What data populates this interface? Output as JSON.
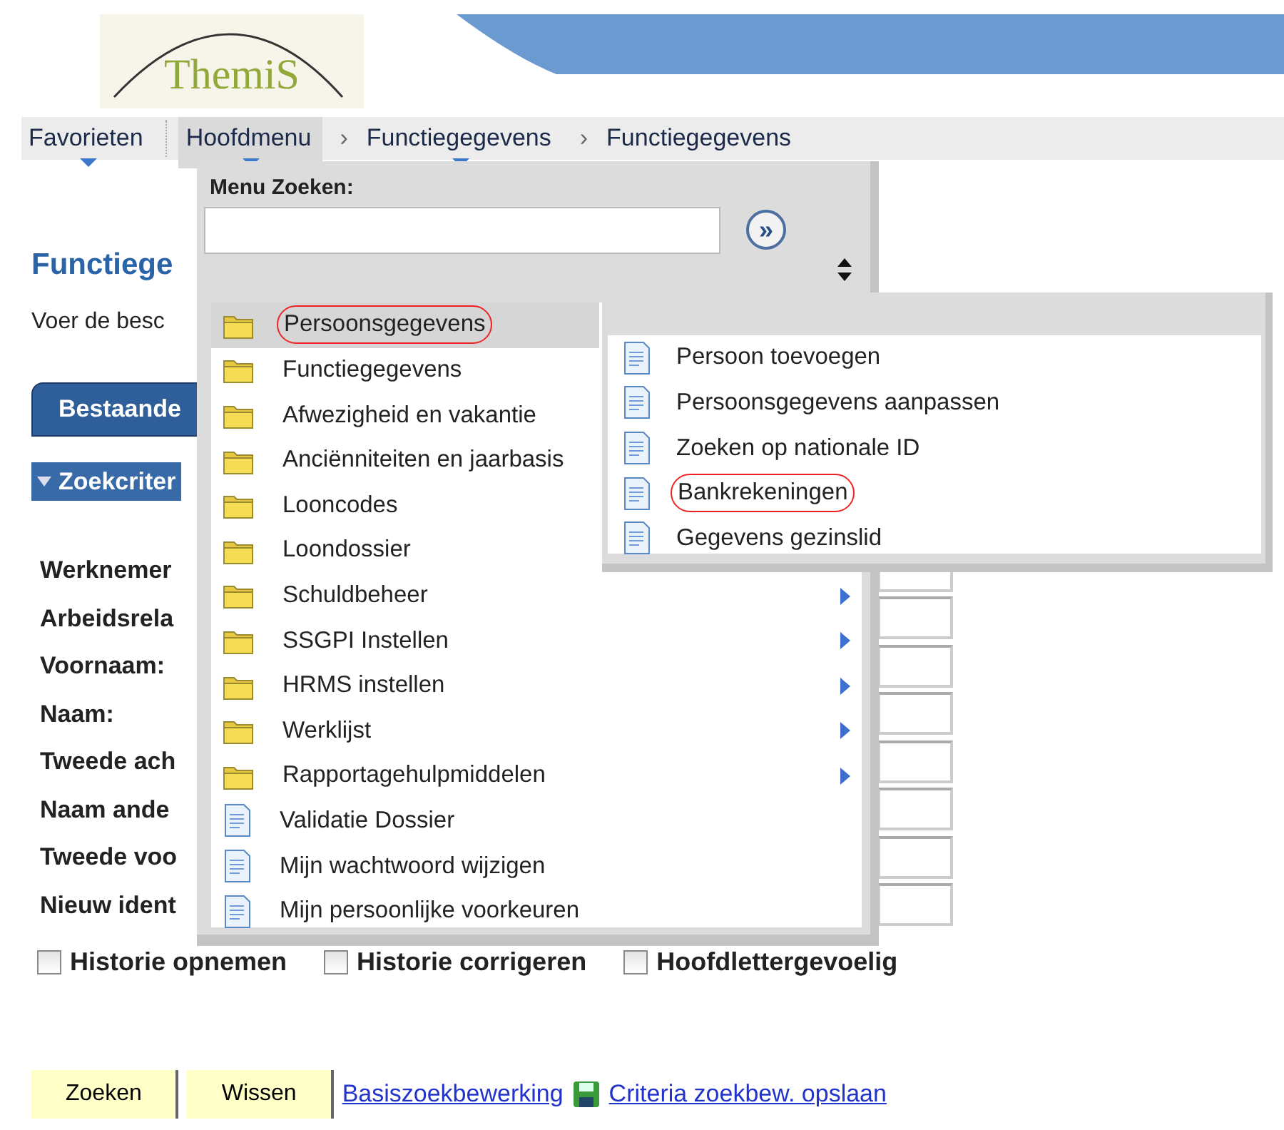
{
  "logo": {
    "text": "ThemiS"
  },
  "nav": [
    {
      "label": "Favorieten",
      "dropdown": true,
      "selected": false
    },
    {
      "label": "Hoofdmenu",
      "dropdown": true,
      "selected": true
    },
    {
      "label": "Functiegegevens",
      "separator": "›",
      "dropdown": true,
      "selected": false
    },
    {
      "label": "Functiegegevens",
      "separator": "›",
      "dropdown": false,
      "selected": false
    }
  ],
  "page": {
    "title": "Functiege",
    "instruction": "Voer de besc",
    "tab": "Bestaande",
    "section": "Zoekcriter",
    "fields": [
      {
        "label": "Werknemer"
      },
      {
        "label": "Arbeidsrela"
      },
      {
        "label": "Voornaam:"
      },
      {
        "label": "Naam:"
      },
      {
        "label": "Tweede ach"
      },
      {
        "label": "Naam ande"
      },
      {
        "label": "Tweede voo"
      },
      {
        "label": "Nieuw ident"
      }
    ],
    "checkboxes": [
      {
        "label": "Historie opnemen",
        "checked": false
      },
      {
        "label": "Historie corrigeren",
        "checked": false
      },
      {
        "label": "Hoofdlettergevoelig",
        "checked": false
      }
    ],
    "buttons": [
      "Zoeken",
      "Wissen"
    ],
    "links": [
      {
        "label": "Basiszoekbewerking",
        "icon": false
      },
      {
        "label": "Criteria zoekbew. opslaan",
        "icon": true
      }
    ]
  },
  "menu": {
    "search_label": "Menu Zoeken:",
    "go_button": "»",
    "items": [
      {
        "kind": "folder",
        "label": "Persoonsgegevens",
        "selected": true,
        "circled": true,
        "submenu_arrow": false
      },
      {
        "kind": "folder",
        "label": "Functiegegevens",
        "selected": false,
        "circled": false,
        "submenu_arrow": false
      },
      {
        "kind": "folder",
        "label": "Afwezigheid en vakantie",
        "selected": false,
        "circled": false,
        "submenu_arrow": false
      },
      {
        "kind": "folder",
        "label": "Anciënniteiten en jaarbasis",
        "selected": false,
        "circled": false,
        "submenu_arrow": false
      },
      {
        "kind": "folder",
        "label": "Looncodes",
        "selected": false,
        "circled": false,
        "submenu_arrow": false
      },
      {
        "kind": "folder",
        "label": "Loondossier",
        "selected": false,
        "circled": false,
        "submenu_arrow": false
      },
      {
        "kind": "folder",
        "label": "Schuldbeheer",
        "selected": false,
        "circled": false,
        "submenu_arrow": true
      },
      {
        "kind": "folder",
        "label": "SSGPI Instellen",
        "selected": false,
        "circled": false,
        "submenu_arrow": true
      },
      {
        "kind": "folder",
        "label": "HRMS instellen",
        "selected": false,
        "circled": false,
        "submenu_arrow": true
      },
      {
        "kind": "folder",
        "label": "Werklijst",
        "selected": false,
        "circled": false,
        "submenu_arrow": true
      },
      {
        "kind": "folder",
        "label": "Rapportagehulpmiddelen",
        "selected": false,
        "circled": false,
        "submenu_arrow": true
      },
      {
        "kind": "page",
        "label": "Validatie Dossier",
        "selected": false,
        "circled": false,
        "submenu_arrow": false
      },
      {
        "kind": "page",
        "label": "Mijn wachtwoord wijzigen",
        "selected": false,
        "circled": false,
        "submenu_arrow": false
      },
      {
        "kind": "page",
        "label": "Mijn persoonlijke voorkeuren",
        "selected": false,
        "circled": false,
        "submenu_arrow": false
      }
    ]
  },
  "submenu": {
    "items": [
      {
        "kind": "page",
        "label": "Persoon toevoegen",
        "circled": false
      },
      {
        "kind": "page",
        "label": "Persoonsgegevens aanpassen",
        "circled": false
      },
      {
        "kind": "page",
        "label": "Zoeken op nationale ID",
        "circled": false
      },
      {
        "kind": "page",
        "label": "Bankrekeningen",
        "circled": true
      },
      {
        "kind": "page",
        "label": "Gegevens gezinslid",
        "circled": false
      }
    ]
  }
}
